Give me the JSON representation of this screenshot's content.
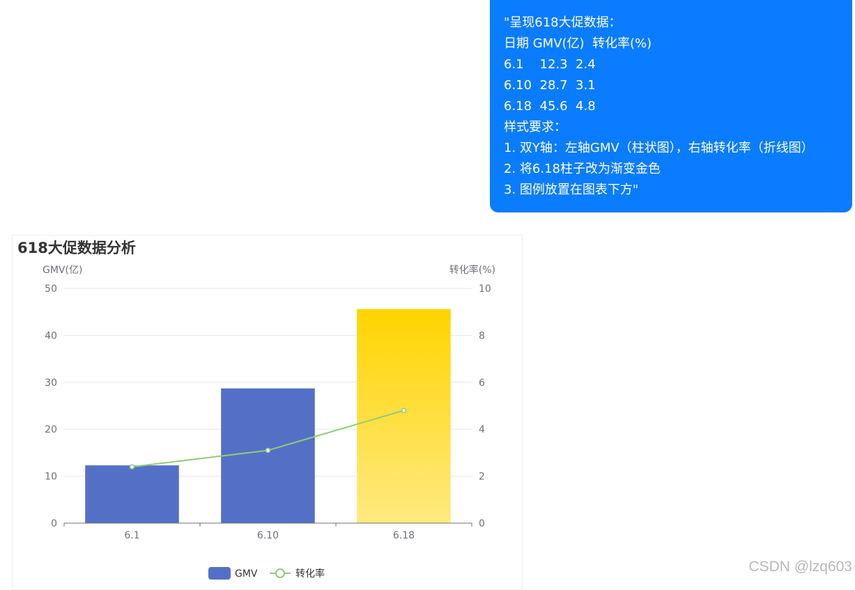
{
  "prompt": {
    "lines": [
      "\"呈现618大促数据：",
      "日期 GMV(亿)  转化率(%)",
      "6.1    12.3  2.4",
      "6.10  28.7  3.1",
      "6.18  45.6  4.8",
      "样式要求：",
      "1. 双Y轴：左轴GMV（柱状图），右轴转化率（折线图）",
      "2. 将6.18柱子改为渐变金色",
      "3. 图例放置在图表下方\""
    ],
    "bubble_color": "#0a7cff"
  },
  "chart_data": {
    "type": "bar",
    "title": "618大促数据分析",
    "categories": [
      "6.1",
      "6.10",
      "6.18"
    ],
    "y_left": {
      "label": "GMV(亿)",
      "range": [
        0,
        50
      ],
      "ticks": [
        0,
        10,
        20,
        30,
        40,
        50
      ]
    },
    "y_right": {
      "label": "转化率(%)",
      "range": [
        0,
        10
      ],
      "ticks": [
        0,
        2,
        4,
        6,
        8,
        10
      ]
    },
    "series": [
      {
        "name": "GMV",
        "type": "bar",
        "axis": "left",
        "values": [
          12.3,
          28.7,
          45.6
        ],
        "color": "#5470c6",
        "highlight": {
          "category": "6.18",
          "gradient": [
            "#ffd400",
            "#ffea80"
          ]
        }
      },
      {
        "name": "转化率",
        "type": "line",
        "axis": "right",
        "values": [
          2.4,
          3.1,
          4.8
        ],
        "color": "#91cc75"
      }
    ],
    "grid": true,
    "legend": "bottom"
  },
  "watermark": "CSDN @lzq603"
}
